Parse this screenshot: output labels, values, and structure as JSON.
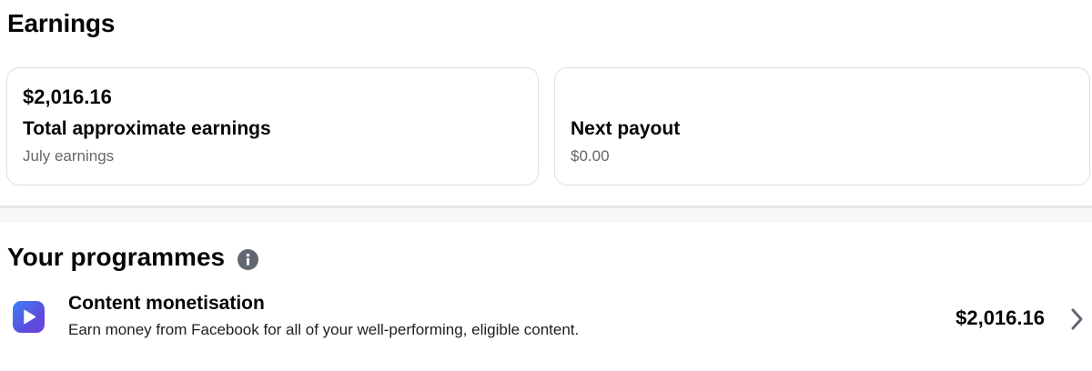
{
  "earnings": {
    "title": "Earnings",
    "total_card": {
      "amount": "$2,016.16",
      "label": "Total approximate earnings",
      "sub": "July earnings"
    },
    "payout_card": {
      "label": "Next payout",
      "sub": "$0.00"
    }
  },
  "programmes": {
    "title": "Your programmes",
    "title_icon": "info-icon",
    "items": [
      {
        "icon": "play-icon",
        "name": "Content monetisation",
        "description": "Earn money from Facebook for all of your well-performing, eligible content.",
        "amount": "$2,016.16",
        "trailing_icon": "chevron-right-icon"
      }
    ]
  },
  "colors": {
    "text_primary": "#050505",
    "text_secondary": "#65676b",
    "card_border": "#dcdfe3",
    "icon_gradient_start": "#3b82f6",
    "icon_gradient_end": "#6d3fd8"
  }
}
